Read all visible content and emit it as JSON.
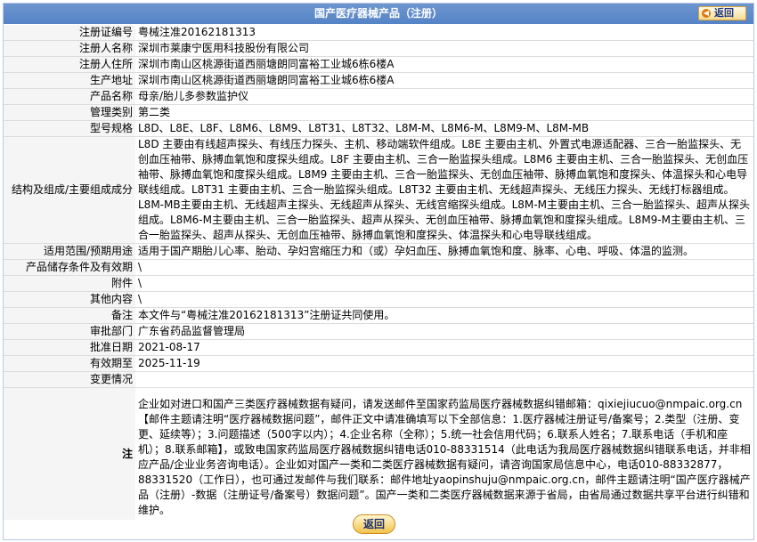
{
  "page_title": "国产医疗器械产品（注册）",
  "back_button_top": "返回",
  "back_button_bottom": "返回",
  "rows": [
    {
      "label": "注册证编号",
      "value": "粤械注准20162181313"
    },
    {
      "label": "注册人名称",
      "value": "深圳市莱康宁医用科技股份有限公司"
    },
    {
      "label": "注册人住所",
      "value": "深圳市南山区桃源街道西丽塘朗同富裕工业城6栋6楼A"
    },
    {
      "label": "生产地址",
      "value": "深圳市南山区桃源街道西丽塘朗同富裕工业城6栋6楼A"
    },
    {
      "label": "产品名称",
      "value": "母亲/胎儿多参数监护仪"
    },
    {
      "label": "管理类别",
      "value": "第二类"
    },
    {
      "label": "型号规格",
      "value": "L8D、L8E、L8F、L8M6、L8M9、L8T31、L8T32、L8M-M、L8M6-M、L8M9-M、L8M-MB"
    },
    {
      "label": "结构及组成/主要组成成分",
      "value": "L8D 主要由有线超声探头、有线压力探头、主机、移动端软件组成。L8E 主要由主机、外置式电源适配器、三合一胎监探头、无创血压袖带、脉搏血氧饱和度探头组成。L8F 主要由主机、三合一胎监探头组成。L8M6 主要由主机、三合一胎监探头、无创血压袖带、脉搏血氧饱和度探头组成。L8M9 主要由主机、三合一胎监探头、无创血压袖带、脉搏血氧饱和度探头、体温探头和心电导联线组成。L8T31 主要由主机、三合一胎监探头组成。L8T32 主要由主机、无线超声探头、无线压力探头、无线打标器组成。L8M-MB主要由主机、无线超声主探头、无线超声从探头、无线宫缩探头组成。L8M-M主要由主机、三合一胎监探头、超声从探头组成。L8M6-M主要由主机、三合一胎监探头、超声从探头、无创血压袖带、脉搏血氧饱和度探头组成。L8M9-M主要由主机、三合一胎监探头、超声从探头、无创血压袖带、脉搏血氧饱和度探头、体温探头和心电导联线组成。"
    },
    {
      "label": "适用范围/预期用途",
      "value": "适用于国产期胎儿心率、胎动、孕妇宫缩压力和（或）孕妇血压、脉搏血氧饱和度、脉率、心电、呼吸、体温的监测。"
    },
    {
      "label": "产品储存条件及有效期",
      "value": "\\"
    },
    {
      "label": "附件",
      "value": "\\"
    },
    {
      "label": "其他内容",
      "value": "\\"
    },
    {
      "label": "备注",
      "value": "本文件与“粤械注准20162181313”注册证共同使用。"
    },
    {
      "label": "审批部门",
      "value": "广东省药品监督管理局"
    },
    {
      "label": "批准日期",
      "value": "2021-08-17"
    },
    {
      "label": "有效期至",
      "value": "2025-11-19"
    },
    {
      "label": "变更情况",
      "value": ""
    }
  ],
  "note": {
    "label": "注",
    "text": "企业如对进口和国产三类医疗器械数据有疑问，请发送邮件至国家药监局医疗器械数据纠错邮箱：qixiejiucuo@nmpaic.org.cn【邮件主题请注明“医疗器械数据问题”，邮件正文中请准确填写以下全部信息：1.医疗器械注册证号/备案号；2.类型（注册、变更、延续等）；3.问题描述（500字以内）；4.企业名称（全称）；5.统一社会信用代码；6.联系人姓名；7.联系电话（手机和座机）；8.联系邮箱】，或致电国家药监局医疗器械数据纠错电话010-88331514（此电话为我局医疗器械数据纠错联系电话，并非相应产品/企业业务咨询电话）。企业如对国产一类和二类医疗器械数据有疑问，请咨询国家局信息中心，电话010-88332877，88331520（工作日），也可通过发邮件与我们联系：邮件地址yaopinshuju@nmpaic.org.cn，邮件主题请注明“国产医疗器械产品（注册）-数据（注册证号/备案号）数据问题”。国产一类和二类医疗器械数据来源于省局，由省局通过数据共享平台进行纠错和维护。"
  },
  "colors": {
    "title_bar": "#5d8ac9",
    "label_bg": "#f5f5f5",
    "button_orange": "#e07812"
  }
}
